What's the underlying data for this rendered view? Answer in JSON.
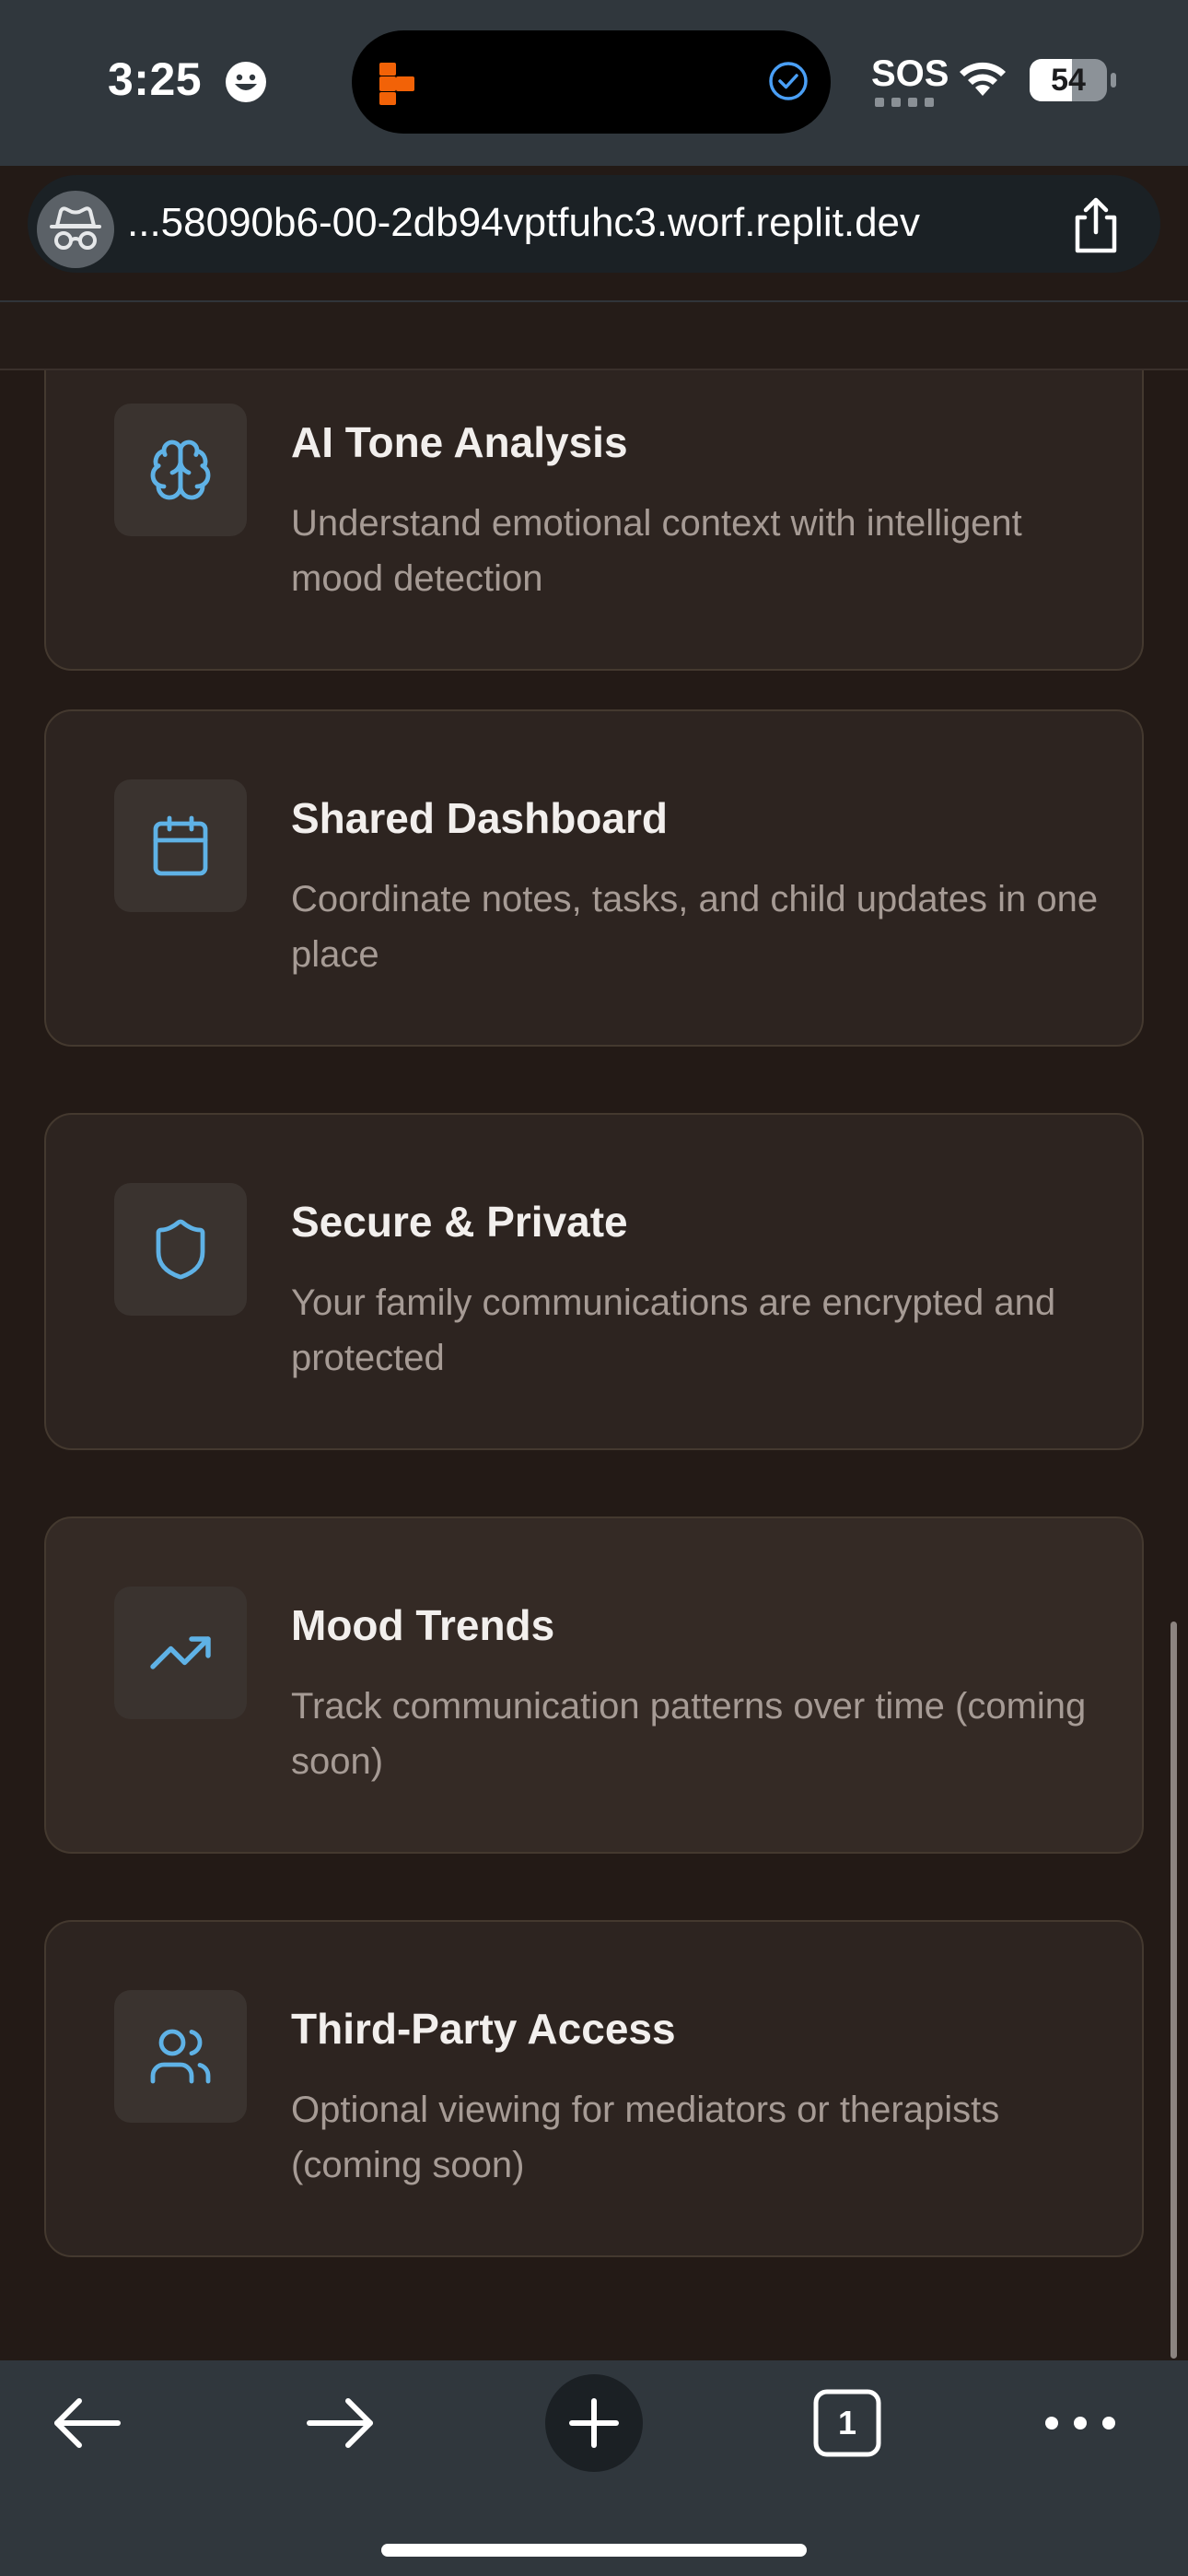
{
  "status_bar": {
    "time": "3:25",
    "sos": "SOS",
    "battery": "54"
  },
  "browser": {
    "url": "...58090b6-00-2db94vptfuhc3.worf.replit.dev",
    "tab_count": "1"
  },
  "features": [
    {
      "icon": "brain-icon",
      "title": "AI Tone Analysis",
      "description": "Understand emotional context with intelligent mood detection"
    },
    {
      "icon": "calendar-icon",
      "title": "Shared Dashboard",
      "description": "Coordinate notes, tasks, and child updates in one place"
    },
    {
      "icon": "shield-icon",
      "title": "Secure & Private",
      "description": "Your family communications are encrypted and protected"
    },
    {
      "icon": "trending-up-icon",
      "title": "Mood Trends",
      "description": "Track communication patterns over time (coming soon)"
    },
    {
      "icon": "users-icon",
      "title": "Third-Party Access",
      "description": "Optional viewing for mediators or therapists (coming soon)"
    }
  ],
  "colors": {
    "accent": "#5fb2e6",
    "page_background": "#231a16",
    "card_background": "#2d2420",
    "browser_chrome": "#30373d"
  }
}
